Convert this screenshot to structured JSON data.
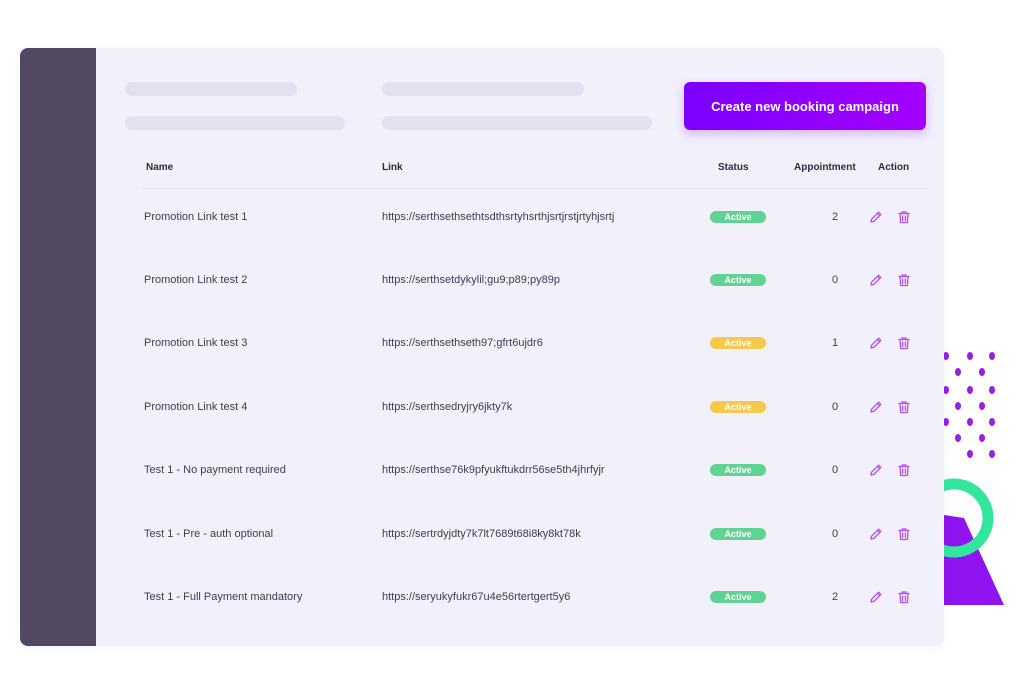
{
  "cta": {
    "label": "Create new booking campaign"
  },
  "table": {
    "headers": {
      "name": "Name",
      "link": "Link",
      "status": "Status",
      "appointment": "Appointment",
      "action": "Action"
    },
    "rows": [
      {
        "name": "Promotion Link test 1",
        "link": "https://serthsethsethtsdthsrtyhsrthjsrtjrstjrtyhjsrtj",
        "status": "Active",
        "status_color": "#5fd393",
        "appointment": "2"
      },
      {
        "name": "Promotion Link test 2",
        "link": "https://serthsetdykylil;gu9;p89;py89p",
        "status": "Active",
        "status_color": "#5fd393",
        "appointment": "0"
      },
      {
        "name": "Promotion Link test 3",
        "link": "https://serthsethseth97;gfrt6ujdr6",
        "status": "Active",
        "status_color": "#f6c84c",
        "appointment": "1"
      },
      {
        "name": "Promotion Link test 4",
        "link": "https://serthsedryjry6jkty7k",
        "status": "Active",
        "status_color": "#f6c84c",
        "appointment": "0"
      },
      {
        "name": "Test 1 - No payment required",
        "link": "https://serthse76k9pfyukftukdrr56se5th4jhrfyjr",
        "status": "Active",
        "status_color": "#5fd393",
        "appointment": "0"
      },
      {
        "name": "Test 1 - Pre - auth optional",
        "link": "https://sertrdyjdty7k7lt7689t68i8ky8kt78k",
        "status": "Active",
        "status_color": "#5fd393",
        "appointment": "0"
      },
      {
        "name": "Test 1 - Full Payment mandatory",
        "link": "https://seryukyfukr67u4e56rtertgert5y6",
        "status": "Active",
        "status_color": "#5fd393",
        "appointment": "2"
      }
    ]
  },
  "icons": {
    "edit": "pencil-icon",
    "delete": "trash-icon"
  },
  "colors": {
    "accent": "#8a00ff",
    "sidebar": "#514961",
    "active_green": "#5fd393",
    "active_yellow": "#f6c84c",
    "action_icon": "#b44cf0"
  }
}
